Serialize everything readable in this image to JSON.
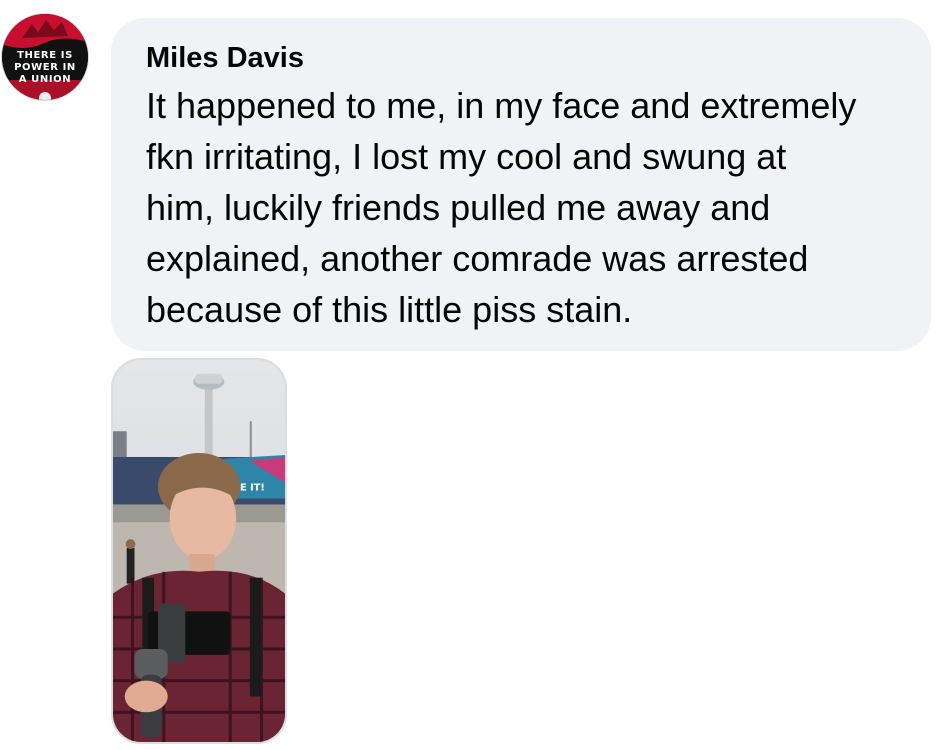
{
  "comment": {
    "author": "Miles Davis",
    "text": "It happened to me, in my face and extremely\nfkn irritating, I lost my cool and swung at\nhim, luckily friends pulled me away and\nexplained, another comrade was arrested\nbecause of this little piss stain.",
    "avatar": {
      "lines": [
        "THERE IS",
        "POWER IN",
        "A UNION"
      ],
      "colors": {
        "background": "#111111",
        "accent": "#c8102e",
        "text": "#ffffff"
      }
    },
    "attachment": {
      "type": "video-thumbnail",
      "sign_text": "E IT!"
    }
  },
  "colors": {
    "bubble": "#f0f2f5",
    "text": "#050505"
  }
}
